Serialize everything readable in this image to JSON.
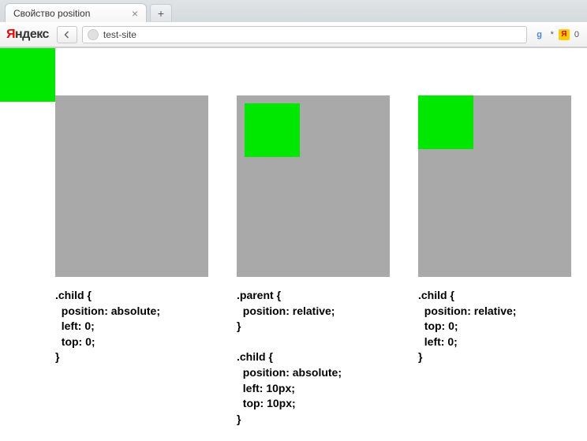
{
  "browser": {
    "tab_title": "Свойство position",
    "url": "test-site",
    "new_tab_plus": "+",
    "close_tab": "×",
    "back_arrow": "←",
    "yandex_label": "ндекс",
    "yandex_first": "Я",
    "ext_star": "*",
    "ext_count": "0",
    "yandex_ext_letter": "Я"
  },
  "examples": {
    "ex1": {
      "code": ".child {\n  position: absolute;\n  left: 0;\n  top: 0;\n}"
    },
    "ex2": {
      "code": ".parent {\n  position: relative;\n}\n\n.child {\n  position: absolute;\n  left: 10px;\n  top: 10px;\n}"
    },
    "ex3": {
      "code": ".child {\n  position: relative;\n  top: 0;\n  left: 0;\n}"
    }
  }
}
